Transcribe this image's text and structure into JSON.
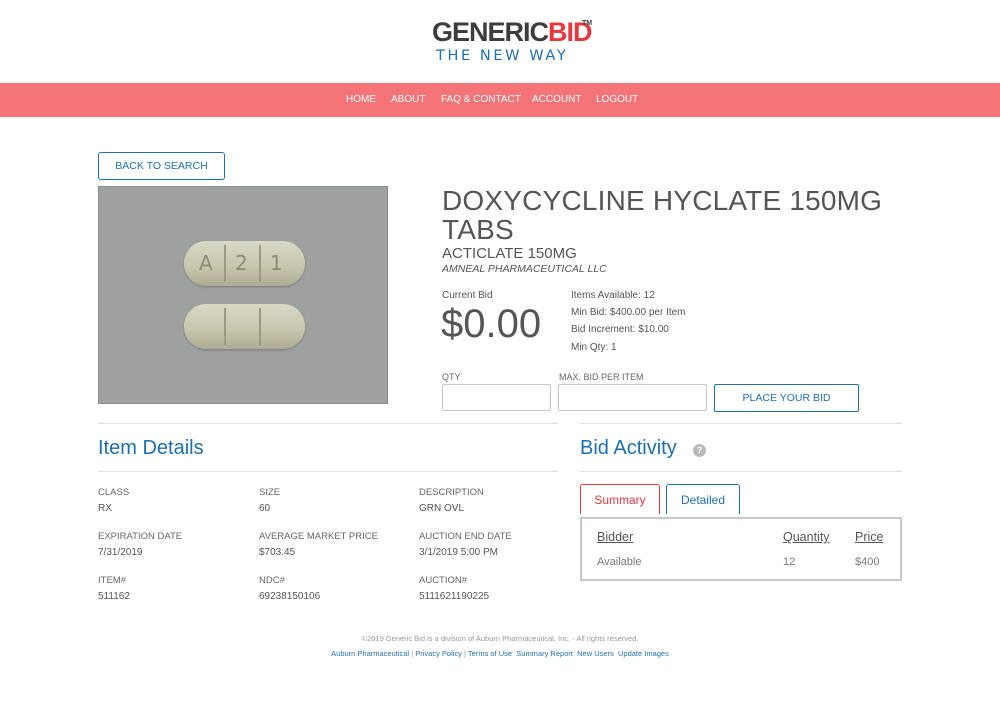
{
  "logo": {
    "part1": "GENERIC",
    "part2": "BID",
    "tm": "TM",
    "tagline": "THE NEW WAY"
  },
  "nav": {
    "items": [
      "HOME",
      "ABOUT",
      "FAQ & CONTACT",
      "ACCOUNT",
      "LOGOUT"
    ]
  },
  "back_button": "BACK TO SEARCH",
  "product": {
    "pill_chars": [
      "A",
      "2",
      "1"
    ],
    "title": "DOXYCYCLINE HYCLATE 150MG TABS",
    "brand": "ACTICLATE 150MG",
    "manufacturer": "AMNEAL PHARMACEUTICAL LLC"
  },
  "bid": {
    "current_label": "Current Bid",
    "current_value": "$0.00",
    "info": [
      "Items Available: 12",
      "Min Bid: $400.00 per Item",
      "Bid Increment: $10.00",
      "Min Qty: 1"
    ],
    "qty_label": "QTY",
    "qty_value": "",
    "max_label": "MAX. BID PER ITEM",
    "max_value": "",
    "place_button": "PLACE YOUR BID"
  },
  "item_details": {
    "heading": "Item Details",
    "fields": [
      {
        "label": "CLASS",
        "value": "RX"
      },
      {
        "label": "SIZE",
        "value": "60"
      },
      {
        "label": "DESCRIPTION",
        "value": "GRN OVL"
      },
      {
        "label": "EXPIRATION DATE",
        "value": "7/31/2019"
      },
      {
        "label": "AVERAGE MARKET PRICE",
        "value": "$703.45"
      },
      {
        "label": "AUCTION END DATE",
        "value": "3/1/2019 5:00 PM"
      },
      {
        "label": "ITEM#",
        "value": "511162"
      },
      {
        "label": "NDC#",
        "value": "69238150106"
      },
      {
        "label": "AUCTION#",
        "value": "5111621190225"
      }
    ]
  },
  "bid_activity": {
    "heading": "Bid Activity",
    "help": "?",
    "tabs": [
      "Summary",
      "Detailed"
    ],
    "columns": [
      "Bidder",
      "Quantity",
      "Price"
    ],
    "rows": [
      [
        "Available",
        "12",
        "$400"
      ]
    ]
  },
  "footer": {
    "copyright": "©2019 Generic Bid is a division of Auburn Pharmaceutical, Inc. - All rights reserved.",
    "links": [
      "Auburn Pharmaceutical",
      "Privacy Policy",
      "Terms of Use",
      "Summary Report",
      "New Users",
      "Update Images"
    ]
  },
  "colors": {
    "nav_bg": "#f47477",
    "accent_blue": "#1f6fb0",
    "accent_red": "#e8383d",
    "image_bg": "#9fa1a1"
  }
}
